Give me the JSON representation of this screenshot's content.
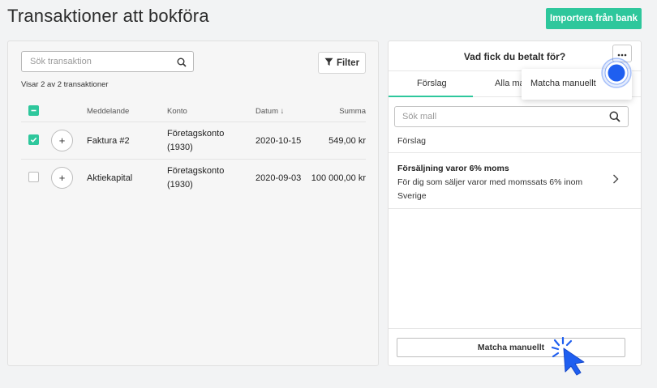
{
  "header": {
    "title": "Transaktioner att bokföra",
    "import_button": "Importera från bank"
  },
  "left": {
    "search_placeholder": "Sök transaktion",
    "filter_label": "Filter",
    "showing_text": "Visar 2 av 2 transaktioner",
    "columns": {
      "message": "Meddelande",
      "account": "Konto",
      "date": "Datum ↓",
      "amount": "Summa"
    },
    "rows": [
      {
        "checked": true,
        "message": "Faktura #2",
        "account_line1": "Företagskonto",
        "account_line2": "(1930)",
        "date": "2020-10-15",
        "amount": "549,00 kr"
      },
      {
        "checked": false,
        "message": "Aktiekapital",
        "account_line1": "Företagskonto",
        "account_line2": "(1930)",
        "date": "2020-09-03",
        "amount": "100 000,00 kr"
      }
    ]
  },
  "right": {
    "title": "Vad fick du betalt för?",
    "tabs": [
      "Förslag",
      "Alla ma"
    ],
    "active_tab": "Förslag",
    "search_placeholder": "Sök mall",
    "section_label": "Förslag",
    "suggestion": {
      "title": "Försäljning varor 6% moms",
      "description": "För dig som säljer varor med momssats 6% inom Sverige"
    },
    "match_button": "Matcha manuellt"
  },
  "dropdown": {
    "item": "Matcha manuellt"
  },
  "colors": {
    "accent": "#2ec79c",
    "highlight": "#1f5ff0"
  }
}
